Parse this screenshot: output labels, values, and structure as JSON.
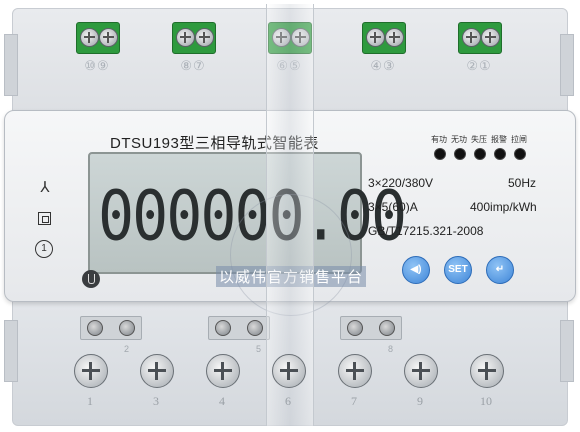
{
  "title": "DTSU193型三相导轨式智能表",
  "display": {
    "reading": "000000.00"
  },
  "specs": {
    "voltage": "3×220/380V",
    "frequency": "50Hz",
    "current": "3×5(60)A",
    "constant": "400imp/kWh",
    "standard": "GB/T17215.321-2008"
  },
  "indicators": [
    {
      "label": "有功"
    },
    {
      "label": "无功"
    },
    {
      "label": "失压"
    },
    {
      "label": "报警"
    },
    {
      "label": "拉闸"
    }
  ],
  "buttons": {
    "left": "◀)",
    "set": "SET",
    "enter": "↵"
  },
  "side": {
    "circle_label": "1"
  },
  "top_terminals": [
    "⑩⑨",
    "⑧⑦",
    "⑥⑤",
    "④③",
    "②①"
  ],
  "bottom_terminals": [
    "1",
    "3",
    "4",
    "6",
    "7",
    "9",
    "10"
  ],
  "bottom_small_numbers": [
    "2",
    "5",
    "8"
  ],
  "watermark": {
    "text": "以威伟官方销售平台"
  },
  "colors": {
    "terminal_green": "#2e9a3e",
    "button_blue": "#3f86d8",
    "lcd": "#c4cdcd"
  }
}
